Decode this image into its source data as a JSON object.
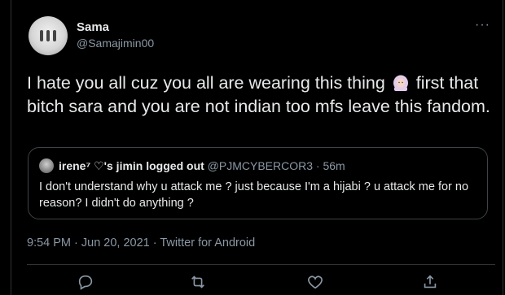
{
  "tweet": {
    "author_name": "Sama",
    "author_handle": "@Samajimin00",
    "text_part1": "I hate you all cuz you all are wearing this thing ",
    "emoji_name": "woman-with-headscarf",
    "text_part2": " first that bitch sara and you are not indian too mfs leave this fandom.",
    "timestamp": "9:54 PM · Jun 20, 2021 · Twitter for Android"
  },
  "quoted": {
    "author_name": "irene⁷ ♡'s jimin logged out",
    "author_handle": "@PJMCYBERCOR3",
    "age": " · 56m",
    "text": "I don't understand why u attack me ? just because I'm a hijabi ? u attack me for no reason? I didn't do anything ?"
  },
  "actions": {
    "reply_icon": "reply-icon",
    "retweet_icon": "retweet-icon",
    "like_icon": "like-icon",
    "share_icon": "share-icon"
  },
  "colors": {
    "background": "#000000",
    "text": "#e7e9ea",
    "secondary": "#8b98a5",
    "border": "#2f3336"
  }
}
